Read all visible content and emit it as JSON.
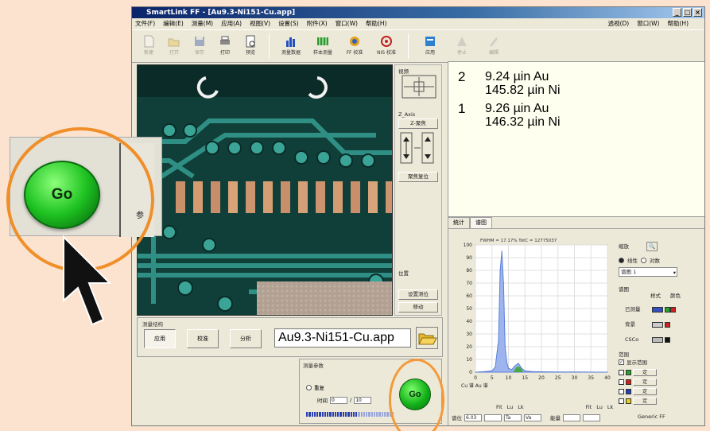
{
  "window": {
    "title": "SmartLink FF - [Au9.3-Ni151-Cu.app]"
  },
  "menu": {
    "left": [
      "文件(F)",
      "编辑(E)",
      "测量(M)",
      "应用(A)",
      "视图(V)",
      "设置(S)",
      "附件(X)",
      "窗口(W)",
      "帮助(H)"
    ],
    "right": [
      "透视(D)",
      "窗口(W)",
      "帮助(H)"
    ]
  },
  "toolbar": {
    "buttons": [
      {
        "label": "新建",
        "icon": "new-file-icon",
        "enabled": false
      },
      {
        "label": "打开",
        "icon": "open-folder-icon",
        "enabled": false
      },
      {
        "label": "保存",
        "icon": "save-icon",
        "enabled": false
      },
      {
        "label": "打印",
        "icon": "print-icon",
        "enabled": true
      },
      {
        "label": "预览",
        "icon": "preview-icon",
        "enabled": true
      },
      {
        "label": "测量数据",
        "icon": "bar-chart-icon",
        "enabled": true
      },
      {
        "label": "样本测量",
        "icon": "sample-grid-icon",
        "enabled": true
      },
      {
        "label": "FF 校准",
        "icon": "calibrate-icon",
        "enabled": true
      },
      {
        "label": "NIS 校准",
        "icon": "target-icon",
        "enabled": true
      },
      {
        "label": "应用",
        "icon": "application-icon",
        "enabled": true
      },
      {
        "label": "停止",
        "icon": "stop-icon",
        "enabled": false
      },
      {
        "label": "编辑",
        "icon": "edit-icon",
        "enabled": false
      }
    ]
  },
  "side_panel": {
    "group_title": "视频",
    "zoom_label": "Z_Axis",
    "zoom_button": "Z-聚焦",
    "focus_button": "聚焦复位",
    "position_label": "位置",
    "set_position_button": "设置测位",
    "move_button": "移动"
  },
  "results": [
    {
      "index": "2",
      "lines": [
        "9.24 µin Au",
        "145.82 µin Ni"
      ]
    },
    {
      "index": "1",
      "lines": [
        "9.26 µin Au",
        "146.32 µin Ni"
      ]
    }
  ],
  "spectrum_tabs": [
    "统计",
    "谱图"
  ],
  "spectrum": {
    "header": "FWHM = 17.17% TotC = 12775037",
    "x_unit_label": "Cu 谱 Au 谱",
    "controls": {
      "zoom_label": "缩放",
      "linear_label": "线性",
      "log_label": "对数",
      "series_select": "谱图 1",
      "style_title": "谱图",
      "columns": [
        "样式",
        "颜色"
      ],
      "rows": [
        "已测量",
        "背景",
        "CSCo"
      ],
      "range_title": "范围",
      "range_check": "显示范围",
      "range_buttons": [
        "定",
        "定",
        "定",
        "定"
      ],
      "footer": "Generic FF"
    },
    "bottom_labels": [
      "Fit",
      "Lu",
      "Lk",
      "Fit",
      "Lu",
      "Lk"
    ],
    "bottom_inputs": [
      "谱位",
      "6.03",
      "Ta",
      "Va",
      "能量"
    ]
  },
  "chart_data": {
    "type": "line",
    "title": "",
    "xlabel": "Cu 谱 Au 谱",
    "ylabel": "",
    "xlim": [
      0,
      40
    ],
    "ylim": [
      0,
      100
    ],
    "xticks": [
      0,
      5,
      10,
      15,
      20,
      25,
      30,
      35,
      40
    ],
    "yticks": [
      0,
      10,
      20,
      30,
      40,
      50,
      60,
      70,
      80,
      90,
      100
    ],
    "grid": true,
    "series": [
      {
        "x": [
          0,
          3,
          5,
          6,
          7,
          7.5,
          8,
          8.5,
          9,
          9.5,
          10,
          11,
          12,
          13,
          14,
          15,
          17,
          20,
          25,
          30,
          40
        ],
        "values": [
          0,
          0.5,
          1,
          4,
          25,
          80,
          95,
          70,
          20,
          8,
          3,
          2,
          5,
          7,
          3,
          1,
          0.5,
          0.3,
          0.2,
          0.1,
          0
        ],
        "color": "#5b7fd8"
      }
    ]
  },
  "mode": {
    "title": "测量结构",
    "buttons": [
      "应用",
      "校准",
      "分析"
    ],
    "active": "应用",
    "application_file": "Au9.3-Ni151-Cu.app"
  },
  "measurement": {
    "title": "测量参数",
    "repeat_label": "重复",
    "time_label": "时间",
    "time_value": "0",
    "time_value2": "10",
    "go_label": "Go",
    "progress": 0.6
  },
  "callout": {
    "go_label": "Go",
    "side_text": "参"
  },
  "colors": {
    "highlight_ring": "#f08f2a",
    "go_button": "#1fc422",
    "results_bg": "#fffff0"
  }
}
